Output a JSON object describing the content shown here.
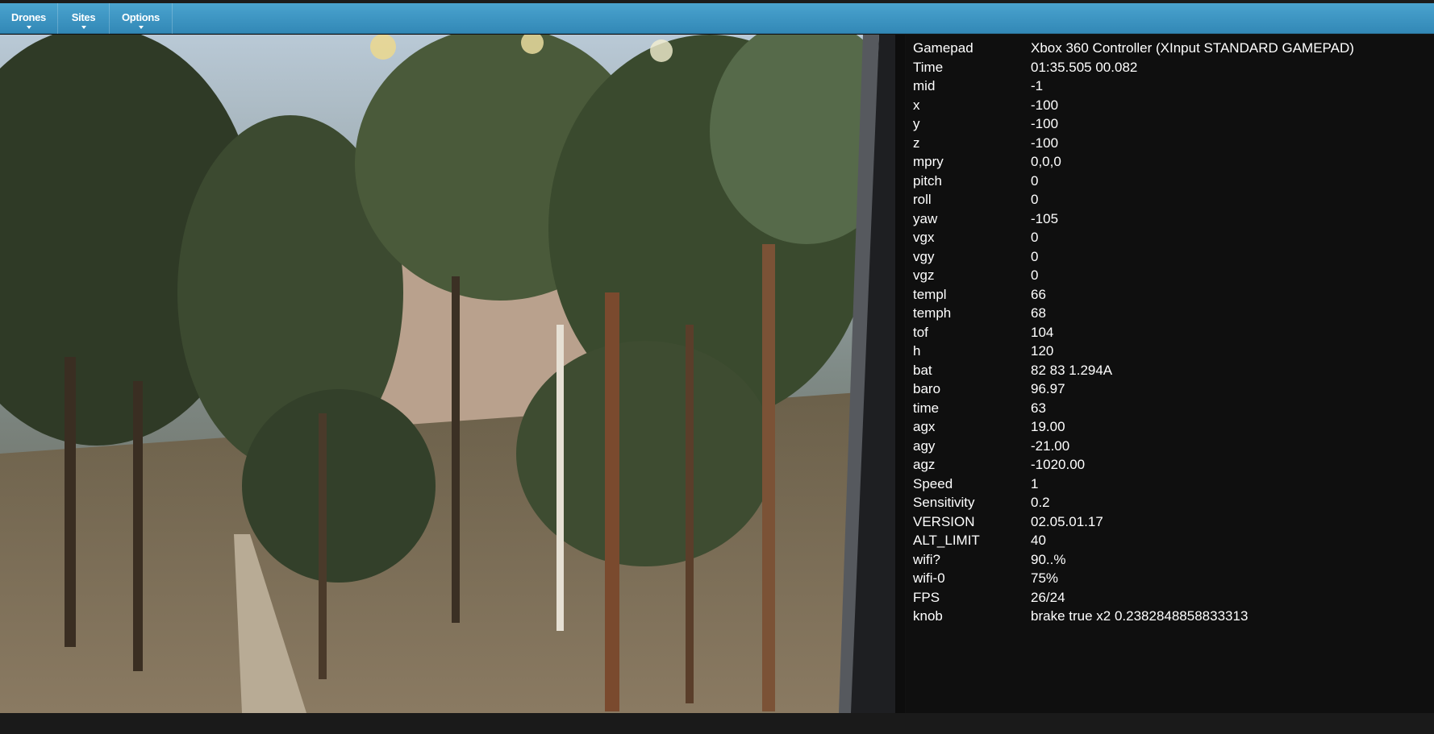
{
  "menu": {
    "items": [
      {
        "id": "drones",
        "label": "Drones"
      },
      {
        "id": "sites",
        "label": "Sites"
      },
      {
        "id": "options",
        "label": "Options"
      }
    ]
  },
  "telemetry": [
    {
      "key": "Gamepad",
      "value": "Xbox 360 Controller (XInput STANDARD GAMEPAD)"
    },
    {
      "key": "Time",
      "value": "01:35.505 00.082"
    },
    {
      "key": "mid",
      "value": "-1"
    },
    {
      "key": "x",
      "value": "-100"
    },
    {
      "key": "y",
      "value": "-100"
    },
    {
      "key": "z",
      "value": "-100"
    },
    {
      "key": "mpry",
      "value": "0,0,0"
    },
    {
      "key": "pitch",
      "value": "0"
    },
    {
      "key": "roll",
      "value": "0"
    },
    {
      "key": "yaw",
      "value": "-105"
    },
    {
      "key": "vgx",
      "value": "0"
    },
    {
      "key": "vgy",
      "value": "0"
    },
    {
      "key": "vgz",
      "value": "0"
    },
    {
      "key": "templ",
      "value": "66"
    },
    {
      "key": "temph",
      "value": "68"
    },
    {
      "key": "tof",
      "value": "104"
    },
    {
      "key": "h",
      "value": "120"
    },
    {
      "key": "bat",
      "value": "82 83 1.294A"
    },
    {
      "key": "baro",
      "value": "96.97"
    },
    {
      "key": "time",
      "value": "63"
    },
    {
      "key": "agx",
      "value": "19.00"
    },
    {
      "key": "agy",
      "value": "-21.00"
    },
    {
      "key": "agz",
      "value": "-1020.00"
    },
    {
      "key": "Speed",
      "value": "1"
    },
    {
      "key": "Sensitivity",
      "value": "0.2"
    },
    {
      "key": "VERSION",
      "value": "02.05.01.17"
    },
    {
      "key": "ALT_LIMIT",
      "value": "40"
    },
    {
      "key": "wifi?",
      "value": "90..%"
    },
    {
      "key": "wifi-0",
      "value": "75%"
    },
    {
      "key": "FPS",
      "value": "26/24"
    },
    {
      "key": "knob",
      "value": "brake true x2 0.2382848858833313"
    }
  ],
  "colors": {
    "menubar": "#3a95c4",
    "panel_bg": "#0f0f0f",
    "text": "#ffffff"
  },
  "icons": {
    "menu_caret": "chevron-down-icon"
  }
}
